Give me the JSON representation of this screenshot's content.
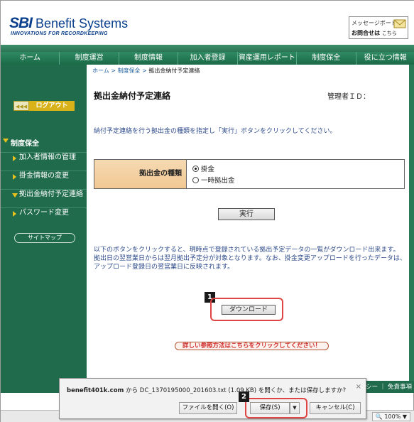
{
  "header": {
    "logo_sbi": "SBI",
    "logo_name": "Benefit Systems",
    "tagline": "INNOVATIONS FOR RECORDKEEPING",
    "message_board": "メッセージボード",
    "inquiry_label": "お問合せは",
    "inquiry_link": "こちら"
  },
  "nav": {
    "items": [
      "ホーム",
      "制度運営",
      "制度情報",
      "加入者登録",
      "資産運用レポート",
      "制度保全",
      "役に立つ情報"
    ]
  },
  "sidebar": {
    "logout_arrows": "◀◀◀",
    "logout_label": "ログアウト",
    "section_label": "制度保全",
    "items": [
      {
        "label": "加入者情報の管理"
      },
      {
        "label": "掛金情報の変更"
      },
      {
        "label": "拠出金納付予定連絡"
      },
      {
        "label": "パスワード変更"
      }
    ],
    "sitemap_label": "サイトマップ"
  },
  "main": {
    "breadcrumb": {
      "home": "ホーム",
      "sep1": " > ",
      "section": "制度保全",
      "sep2": " > ",
      "current": "拠出金納付予定連絡"
    },
    "page_title": "拠出金納付予定連絡",
    "admin_id_label": "管理者ＩＤ：",
    "instruction": "納付予定連絡を行う拠出金の種類を指定し「実行」ボタンをクリックしてください。",
    "form": {
      "label": "拠出金の種類",
      "options": [
        {
          "label": "掛金",
          "selected": true
        },
        {
          "label": "一時拠出金",
          "selected": false
        }
      ]
    },
    "execute_label": "実行",
    "note_lines": [
      "以下のボタンをクリックすると、現時点で登録されている拠出予定データの一覧がダウンロード出来ます。",
      "拠出日の翌営業日からは翌月拠出予定分が対象となります。なお、掛金変更アップロードを行ったデータは、",
      "アップロード登録日の翌営業日に反映されます。"
    ],
    "step1": "1",
    "download_label": "ダウンロード",
    "detail_link": "詳しい参照方法はこちらをクリックしてください！"
  },
  "footer": {
    "links": "リシー ｜ 免責事項"
  },
  "dialog": {
    "site": "benefit401k.com",
    "message_rest": " から DC_1370195000_201603.txt (1.09 KB) を開くか、または保存しますか?",
    "step2": "2",
    "open_label": "ファイルを開く(O)",
    "save_label": "保存(S)",
    "save_arrow": "▼",
    "cancel_label": "キャンセル(C)",
    "close": "×"
  },
  "statusbar": {
    "zoom": "🔍 100%  ▼"
  },
  "colors": {
    "brand_green": "#1f6b4c",
    "accent_yellow": "#d9b21a",
    "highlight_red": "#e04545",
    "link_blue": "#2d4a8a"
  }
}
